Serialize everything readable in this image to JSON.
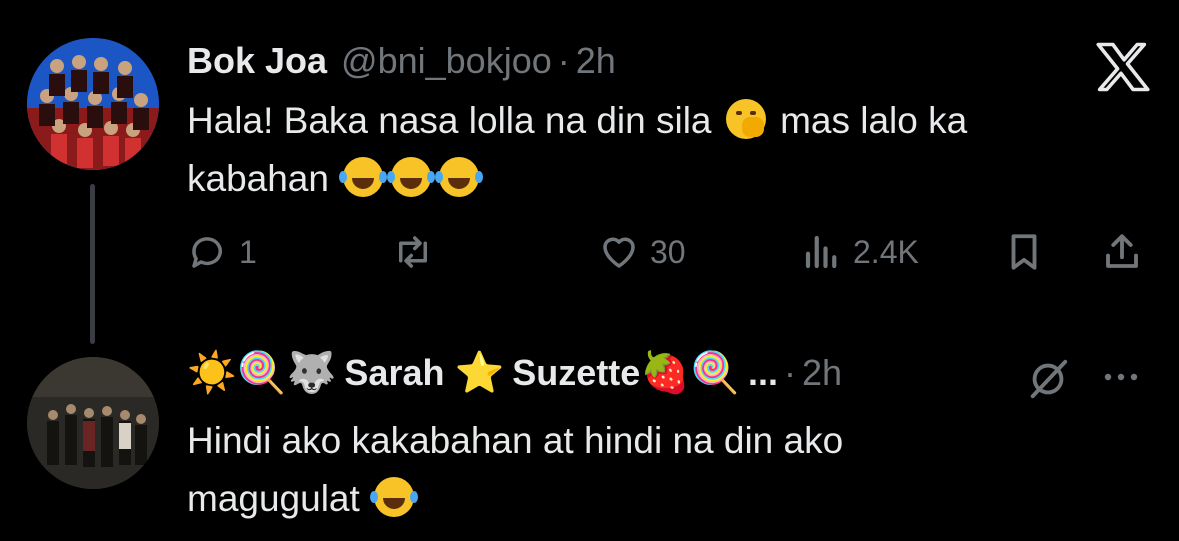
{
  "tweet1": {
    "name": "Bok Joa",
    "handle": "@bni_bokjoo",
    "separator": "·",
    "time": "2h",
    "text_line1_a": "Hala! Baka nasa lolla na din sila",
    "text_line1_b": "mas lalo ka",
    "text_line2": "kabahan",
    "stats": {
      "replies": "1",
      "likes": "30",
      "views": "2.4K"
    }
  },
  "tweet2": {
    "name_prefix_emoji": "☀️🍭🐺",
    "name_part1": "Sarah",
    "name_star": "⭐",
    "name_part2": "Suzette",
    "name_suffix_emoji": "🍓🍭",
    "name_ellipsis": "...",
    "separator": "·",
    "time": "2h",
    "text_line1": "Hindi ako kakabahan at hindi na din ako",
    "text_line2": "magugulat"
  },
  "icons": {
    "x_logo": "x-logo-icon",
    "reply": "reply-icon",
    "retweet": "retweet-icon",
    "like": "heart-icon",
    "views": "views-icon",
    "bookmark": "bookmark-icon",
    "share": "share-icon",
    "grok": "grok-icon",
    "more": "more-icon"
  }
}
